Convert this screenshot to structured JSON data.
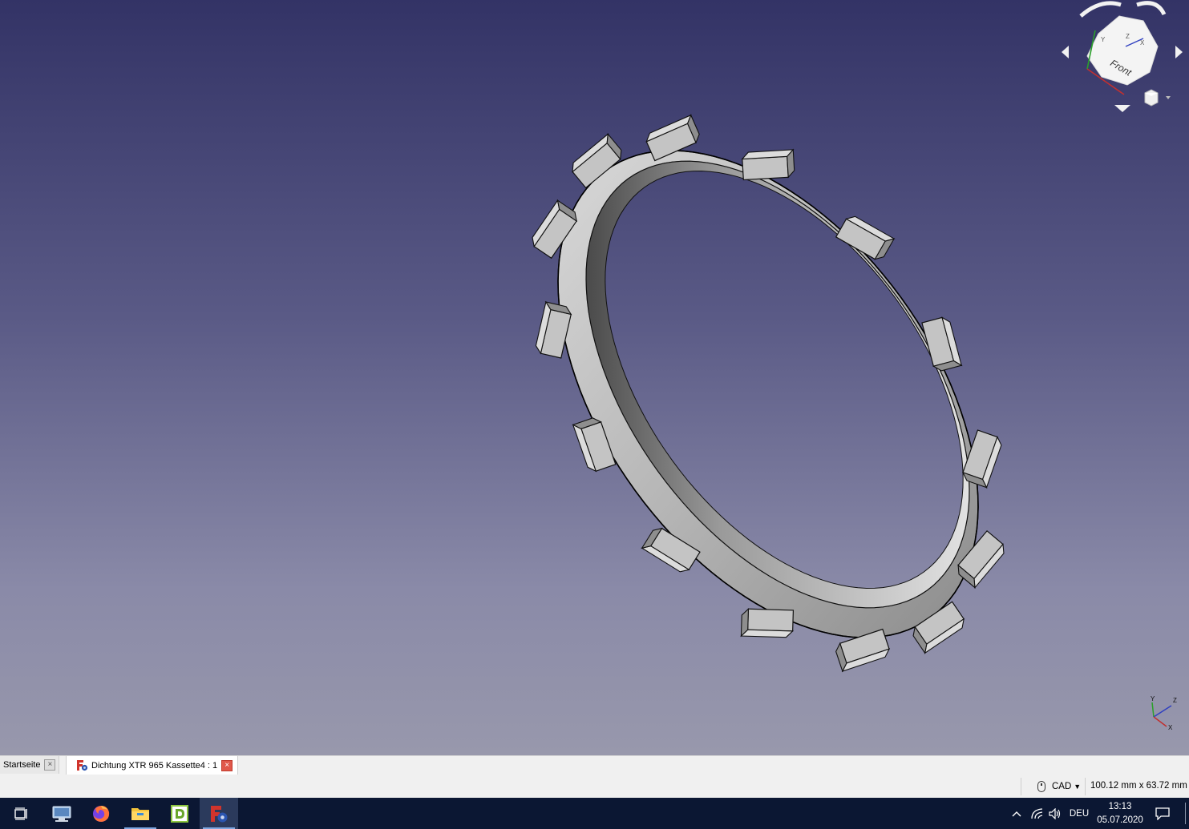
{
  "viewport": {
    "background_top": "#333366",
    "background_bottom": "#9898ac",
    "navcube": {
      "face_label": "Front",
      "axis_labels": [
        "Y",
        "Z",
        "X"
      ]
    },
    "axis_indicator": {
      "labels": [
        "Y",
        "Z",
        "X"
      ]
    }
  },
  "tabs": [
    {
      "label": "Startseite",
      "close": "×"
    },
    {
      "label": "Dichtung XTR 965 Kassette4 : 1",
      "close": "×"
    }
  ],
  "statusbar": {
    "navigation_style": "CAD",
    "dimensions": "100.12 mm x 63.72 mm"
  },
  "taskbar": {
    "apps": [
      "task-view-icon",
      "app-icon",
      "firefox-icon",
      "file-explorer-icon",
      "d-app-icon",
      "freecad-icon"
    ],
    "tray": {
      "language": "DEU",
      "time": "13:13",
      "date": "05.07.2020"
    }
  },
  "colors": {
    "taskbar": "#0b1733",
    "model_surface": "#b0b0b0",
    "model_edge": "#000000"
  }
}
